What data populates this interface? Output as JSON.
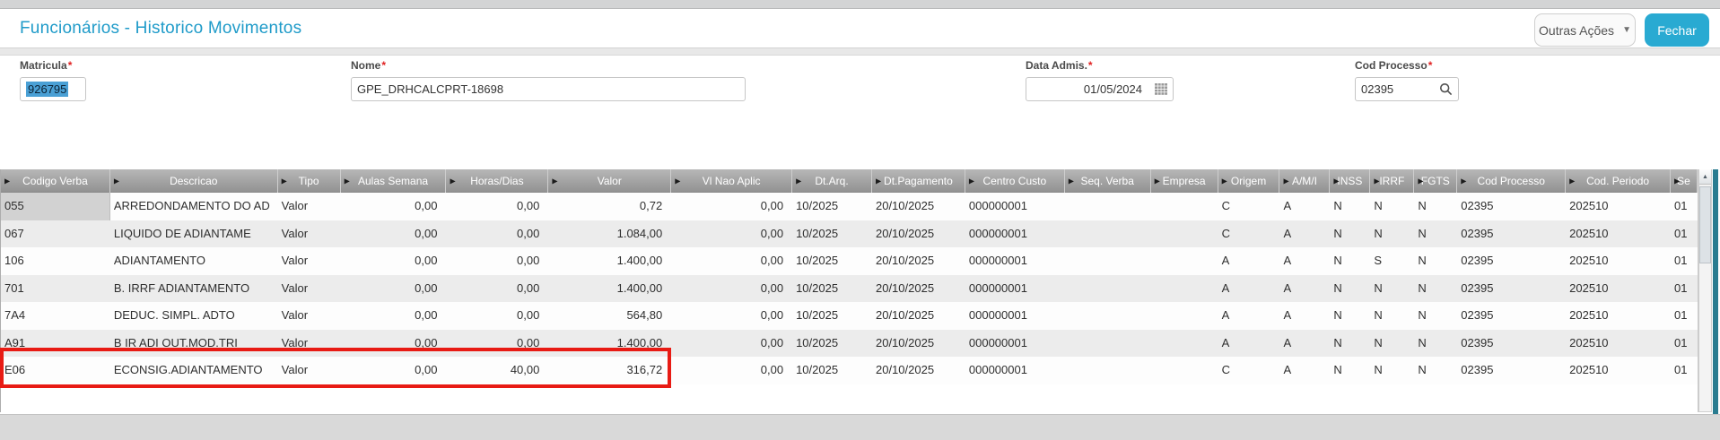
{
  "window": {
    "title": "Funcionários - Historico Movimentos"
  },
  "toolbar": {
    "other_actions_label": "Outras Ações",
    "close_label": "Fechar",
    "caret_icon": "▼"
  },
  "form": {
    "required_marker": "*",
    "matricula": {
      "label": "Matricula",
      "value": "926795"
    },
    "nome": {
      "label": "Nome",
      "value": "GPE_DRHCALCPRT-18698"
    },
    "data_admissao": {
      "label": "Data Admis.",
      "value": "01/05/2024"
    },
    "cod_processo": {
      "label": "Cod Processo",
      "value": "02395"
    }
  },
  "grid": {
    "sort_arrow_icon": "▶",
    "columns": [
      "Codigo Verba",
      "Descricao",
      "Tipo",
      "Aulas Semana",
      "Horas/Dias",
      "Valor",
      "Vl Nao Aplic",
      "Dt.Arq.",
      "Dt.Pagamento",
      "Centro Custo",
      "Seq. Verba",
      "Empresa",
      "Origem",
      "A/M/I",
      "INSS",
      "IRRF",
      "FGTS",
      "Cod Processo",
      "Cod. Periodo",
      "Se"
    ],
    "rows": [
      [
        "055",
        "ARREDONDAMENTO DO AD",
        "Valor",
        "0,00",
        "0,00",
        "0,72",
        "0,00",
        "10/2025",
        "20/10/2025",
        "000000001",
        "",
        "",
        "C",
        "A",
        "N",
        "N",
        "N",
        "02395",
        "202510",
        "01"
      ],
      [
        "067",
        "LIQUIDO DE ADIANTAME",
        "Valor",
        "0,00",
        "0,00",
        "1.084,00",
        "0,00",
        "10/2025",
        "20/10/2025",
        "000000001",
        "",
        "",
        "C",
        "A",
        "N",
        "N",
        "N",
        "02395",
        "202510",
        "01"
      ],
      [
        "106",
        "ADIANTAMENTO",
        "Valor",
        "0,00",
        "0,00",
        "1.400,00",
        "0,00",
        "10/2025",
        "20/10/2025",
        "000000001",
        "",
        "",
        "A",
        "A",
        "N",
        "S",
        "N",
        "02395",
        "202510",
        "01"
      ],
      [
        "701",
        "B. IRRF ADIANTAMENTO",
        "Valor",
        "0,00",
        "0,00",
        "1.400,00",
        "0,00",
        "10/2025",
        "20/10/2025",
        "000000001",
        "",
        "",
        "A",
        "A",
        "N",
        "N",
        "N",
        "02395",
        "202510",
        "01"
      ],
      [
        "7A4",
        "DEDUC. SIMPL. ADTO",
        "Valor",
        "0,00",
        "0,00",
        "564,80",
        "0,00",
        "10/2025",
        "20/10/2025",
        "000000001",
        "",
        "",
        "A",
        "A",
        "N",
        "N",
        "N",
        "02395",
        "202510",
        "01"
      ],
      [
        "A91",
        "B IR ADI OUT.MOD.TRI",
        "Valor",
        "0,00",
        "0,00",
        "1.400,00",
        "0,00",
        "10/2025",
        "20/10/2025",
        "000000001",
        "",
        "",
        "A",
        "A",
        "N",
        "N",
        "N",
        "02395",
        "202510",
        "01"
      ],
      [
        "E06",
        "ECONSIG.ADIANTAMENTO",
        "Valor",
        "0,00",
        "40,00",
        "316,72",
        "0,00",
        "10/2025",
        "20/10/2025",
        "000000001",
        "",
        "",
        "C",
        "A",
        "N",
        "N",
        "N",
        "02395",
        "202510",
        "01"
      ]
    ],
    "highlighted_row_index": 6,
    "scroll_up_icon": "▲"
  },
  "colors": {
    "accent_teal": "#29aad2",
    "title_teal": "#1f9bc9",
    "highlight_red": "#e81b14",
    "selection_blue": "#4aa0d5"
  }
}
